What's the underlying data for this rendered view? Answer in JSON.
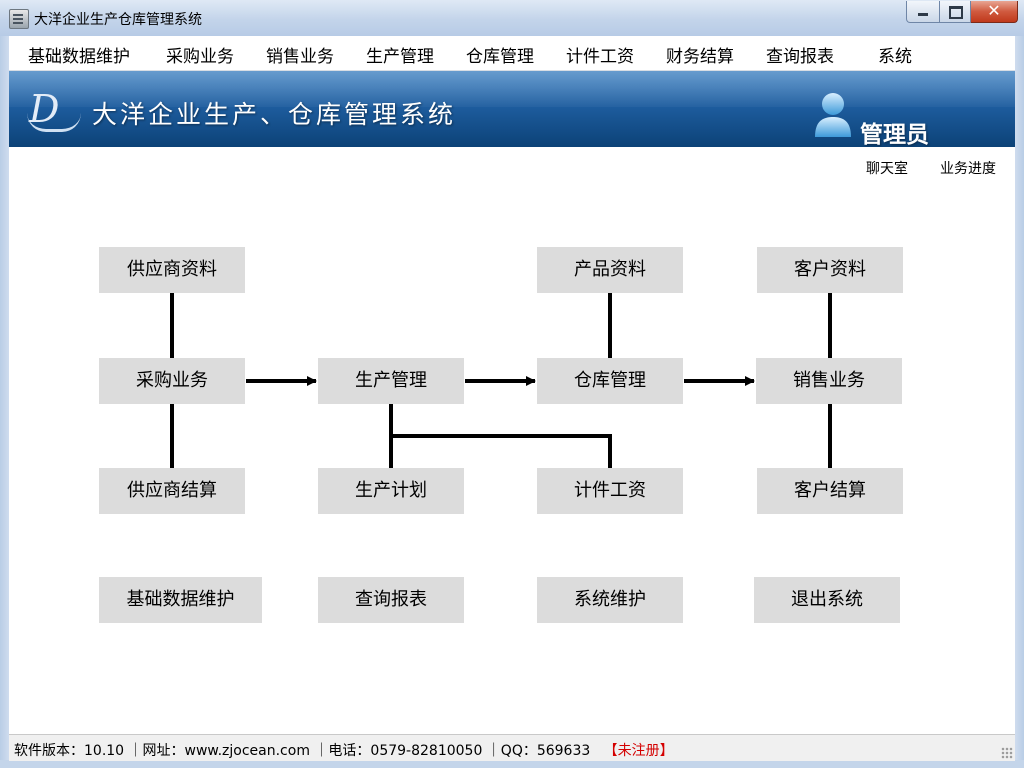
{
  "window": {
    "title": "大洋企业生产仓库管理系统",
    "close_glyph": "✕"
  },
  "menubar": {
    "items": [
      {
        "label": "基础数据维护"
      },
      {
        "label": "采购业务"
      },
      {
        "label": "销售业务"
      },
      {
        "label": "生产管理"
      },
      {
        "label": "仓库管理"
      },
      {
        "label": "计件工资"
      },
      {
        "label": "财务结算"
      },
      {
        "label": "查询报表"
      },
      {
        "label": "系统"
      }
    ]
  },
  "banner": {
    "logo_letter": "D",
    "title": "大洋企业生产、仓库管理系统",
    "user": "管理员",
    "user_icon": "user-avatar-icon"
  },
  "links": {
    "chat": "聊天室",
    "progress": "业务进度"
  },
  "flow": {
    "supplier_info": "供应商资料",
    "product_info": "产品资料",
    "customer_info": "客户资料",
    "purchasing": "采购业务",
    "production": "生产管理",
    "warehouse": "仓库管理",
    "sales": "销售业务",
    "supplier_settlement": "供应商结算",
    "production_plan": "生产计划",
    "piece_wage": "计件工资",
    "customer_settlement": "客户结算",
    "base_data": "基础数据维护",
    "reports": "查询报表",
    "system_maintenance": "系统维护",
    "exit": "退出系统"
  },
  "statusbar": {
    "text": "软件版本：10.10 ｜网址：www.zjocean.com ｜电话：0579-82810050 ｜QQ：569633",
    "registration": "【未注册】"
  },
  "colors": {
    "banner_dark": "#0c4277",
    "banner_light": "#3b7fc0",
    "node_bg": "#dcdcdc",
    "unregistered": "#d40000"
  }
}
